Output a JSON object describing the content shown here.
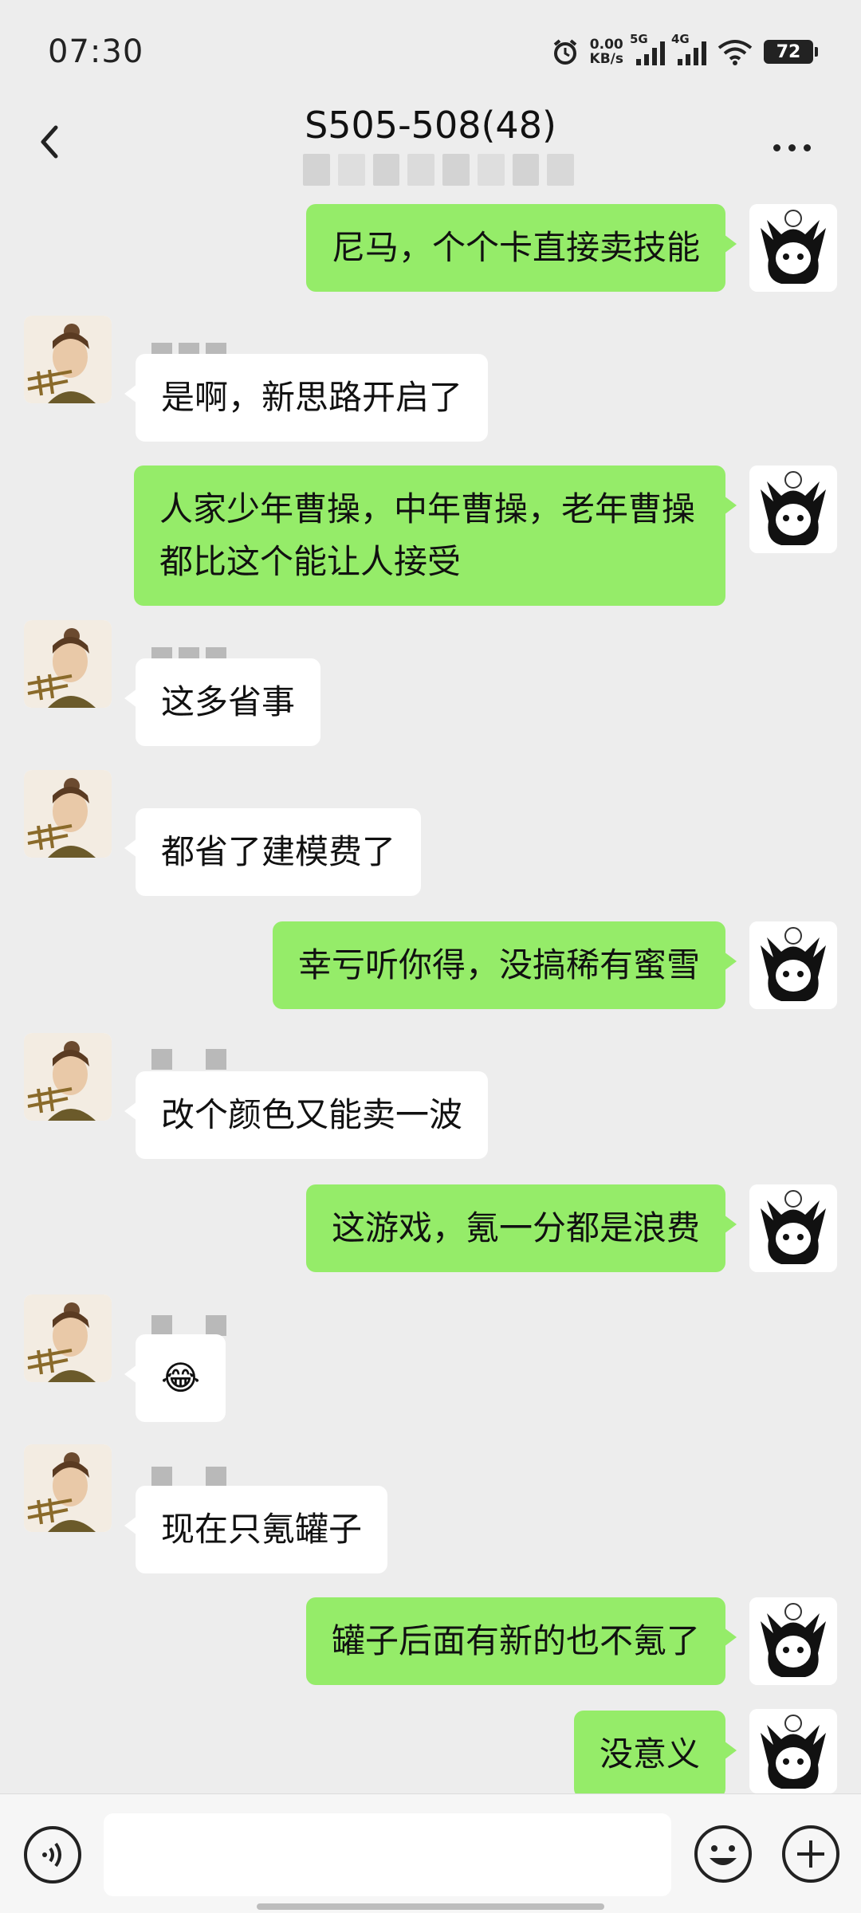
{
  "status_bar": {
    "time": "07:30",
    "net_speed_value": "0.00",
    "net_speed_unit": "KB/s",
    "sim1": "5G",
    "sim2": "4G",
    "battery": "72"
  },
  "header": {
    "title": "S505-508(48)"
  },
  "colors": {
    "my_bubble": "#95ec69",
    "other_bubble": "#ffffff",
    "background": "#ededed"
  },
  "messages": [
    {
      "from": "me",
      "text": "尼马，个个卡直接卖技能"
    },
    {
      "from": "other",
      "text": "是啊，新思路开启了"
    },
    {
      "from": "me",
      "text": "人家少年曹操，中年曹操，老年曹操都比这个能让人接受"
    },
    {
      "from": "other",
      "text": "这多省事"
    },
    {
      "from": "other",
      "text": "都省了建模费了"
    },
    {
      "from": "me",
      "text": "幸亏听你得，没搞稀有蜜雪"
    },
    {
      "from": "other",
      "text": "改个颜色又能卖一波"
    },
    {
      "from": "me",
      "text": "这游戏，氪一分都是浪费"
    },
    {
      "from": "other",
      "text": "😂"
    },
    {
      "from": "other",
      "text": "现在只氪罐子"
    },
    {
      "from": "me",
      "text": "罐子后面有新的也不氪了"
    },
    {
      "from": "me",
      "text": "没意义"
    }
  ],
  "icons": {
    "back": "chevron-left-icon",
    "more": "ellipsis-icon",
    "voice": "voice-icon",
    "emoji": "smiley-icon",
    "plus": "plus-icon"
  }
}
